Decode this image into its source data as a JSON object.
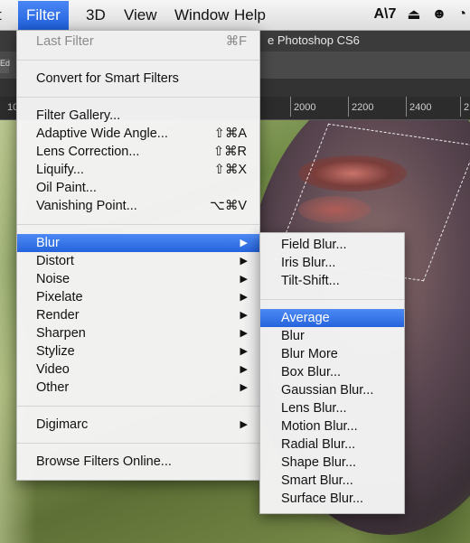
{
  "menubar": {
    "items": [
      "t",
      "Filter",
      "3D",
      "View",
      "Window",
      "Help"
    ],
    "status": [
      "7",
      "⏏",
      "☻",
      "◔"
    ]
  },
  "app": {
    "window_title": "e Photoshop CS6",
    "tab_fragment": "Ed",
    "ruler_ticks": [
      "10",
      "2000",
      "2200",
      "2400",
      "2"
    ]
  },
  "filter_menu": {
    "last_filter": {
      "label": "Last Filter",
      "shortcut": "⌘F"
    },
    "convert": "Convert for Smart Filters",
    "group1": [
      {
        "label": "Filter Gallery...",
        "shortcut": ""
      },
      {
        "label": "Adaptive Wide Angle...",
        "shortcut": "⇧⌘A"
      },
      {
        "label": "Lens Correction...",
        "shortcut": "⇧⌘R"
      },
      {
        "label": "Liquify...",
        "shortcut": "⇧⌘X"
      },
      {
        "label": "Oil Paint...",
        "shortcut": ""
      },
      {
        "label": "Vanishing Point...",
        "shortcut": "⌥⌘V"
      }
    ],
    "submenus": [
      "Blur",
      "Distort",
      "Noise",
      "Pixelate",
      "Render",
      "Sharpen",
      "Stylize",
      "Video",
      "Other"
    ],
    "digimarc": "Digimarc",
    "browse": "Browse Filters Online..."
  },
  "blur_menu": {
    "group1": [
      "Field Blur...",
      "Iris Blur...",
      "Tilt-Shift..."
    ],
    "group2": [
      "Average",
      "Blur",
      "Blur More",
      "Box Blur...",
      "Gaussian Blur...",
      "Lens Blur...",
      "Motion Blur...",
      "Radial Blur...",
      "Shape Blur...",
      "Smart Blur...",
      "Surface Blur..."
    ]
  },
  "colors": {
    "highlight": "#2f6fe0",
    "menu_bg": "#f5f5f5",
    "chrome": "#3b3b3b"
  }
}
